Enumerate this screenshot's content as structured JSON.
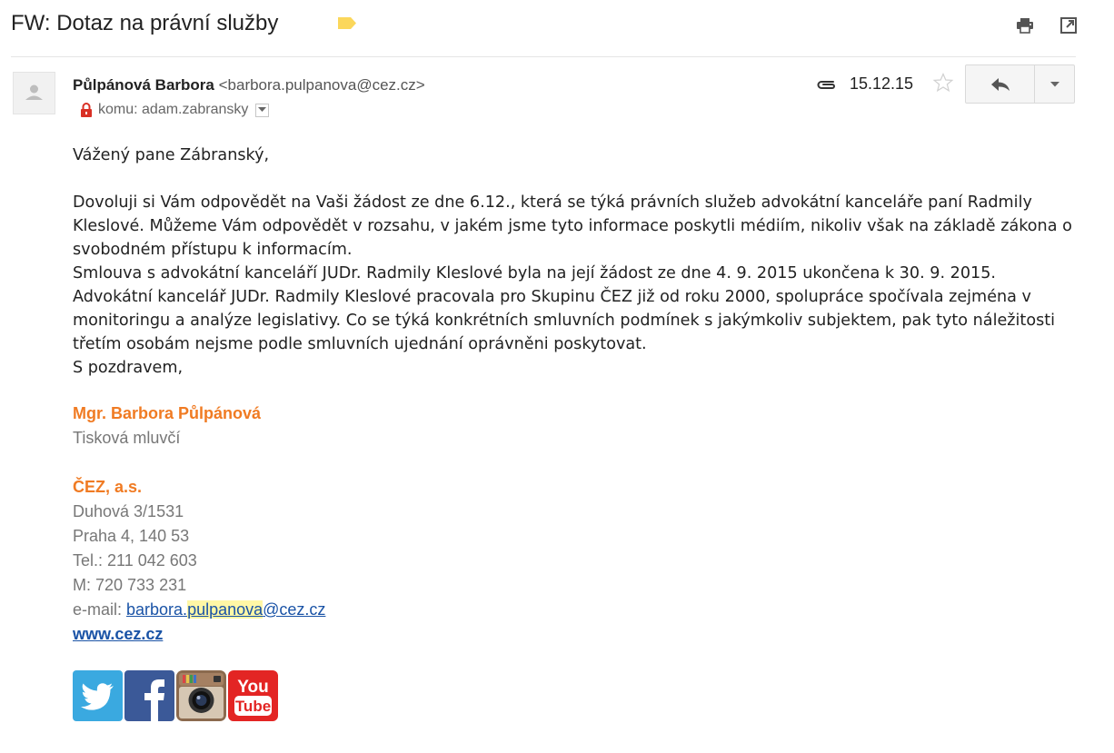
{
  "subject": "FW: Dotaz na právní služby",
  "message": {
    "sender_name": "Půlpánová Barbora",
    "sender_email": "<barbora.pulpanova@cez.cz>",
    "recipient": "komu: adam.zabransky",
    "date": "15.12.15"
  },
  "body": {
    "greeting": "Vážený pane Zábranský,",
    "paragraphs": [
      "Dovoluji si Vám odpovědět na Vaši žádost ze dne 6.12., která se týká právních služeb advokátní kanceláře paní Radmily Kleslové. Můžeme Vám odpovědět v rozsahu, v jakém jsme tyto informace poskytli médiím, nikoliv však na základě zákona o svobodném přístupu k informacím.",
      "Smlouva s advokátní kanceláří JUDr. Radmily Kleslové byla na její žádost ze dne 4. 9. 2015 ukončena k 30. 9. 2015. Advokátní kancelář JUDr. Radmily Kleslové pracovala pro Skupinu ČEZ již od roku 2000, spolupráce spočívala zejména v monitoringu a analýze legislativy. Co se týká konkrétních smluvních podmínek s jakýmkoliv subjektem, pak tyto náležitosti třetím osobám nejsme podle smluvních ujednání oprávněni poskytovat.",
      "S pozdravem,"
    ]
  },
  "signature": {
    "name": "Mgr. Barbora Půlpánová",
    "title": "Tisková mluvčí",
    "company": "ČEZ, a.s.",
    "street": "Duhová 3/1531",
    "city": "Praha 4, 140 53",
    "tel": "Tel.: 211 042 603",
    "mobile": "M: 720 733 231",
    "email_label": "e-mail: ",
    "email_part1": "barbora.",
    "email_part2": "pulpanova",
    "email_part3": "@cez.cz",
    "web": "www.cez.cz"
  },
  "social": {
    "youtube_line1": "You",
    "youtube_line2": "Tube"
  },
  "colors": {
    "accent_orange": "#f07b23",
    "link_blue": "#1a53a6",
    "label_yellow": "#fbd75b",
    "lock_red": "#d93025"
  },
  "icons": [
    "label-icon",
    "print-icon",
    "new-window-icon",
    "person-icon",
    "lock-icon",
    "paperclip-icon",
    "star-icon",
    "reply-icon",
    "chevron-down-icon",
    "twitter-icon",
    "facebook-icon",
    "instagram-icon",
    "youtube-icon"
  ]
}
